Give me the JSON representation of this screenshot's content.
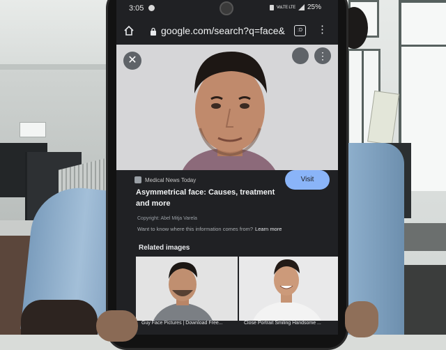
{
  "status_bar": {
    "time": "3:05",
    "network": "VoLTE LTE",
    "battery": "25%"
  },
  "browser": {
    "url": "google.com/search?q=face&",
    "tabs_count": ":D"
  },
  "result": {
    "source": "Medical News Today",
    "visit_label": "Visit",
    "title": "Asymmetrical face: Causes, treatment and more",
    "copyright": "Copyright: Abel Mitja Varela",
    "info_prompt": "Want to know where this information comes from?",
    "learn_more": "Learn more"
  },
  "related": {
    "heading": "Related images",
    "items": [
      {
        "caption": "Guy Face Pictures | Download Free..."
      },
      {
        "caption": "Close Portrait Smiling Handsome ..."
      }
    ]
  },
  "icons": [
    "home-icon",
    "lock-icon",
    "tabs-icon",
    "menu-icon",
    "close-icon",
    "lens-icon",
    "more-icon"
  ],
  "colors": {
    "screen_bg": "#202124",
    "visit_button": "#8ab4f8",
    "control_button": "#5f6368"
  }
}
